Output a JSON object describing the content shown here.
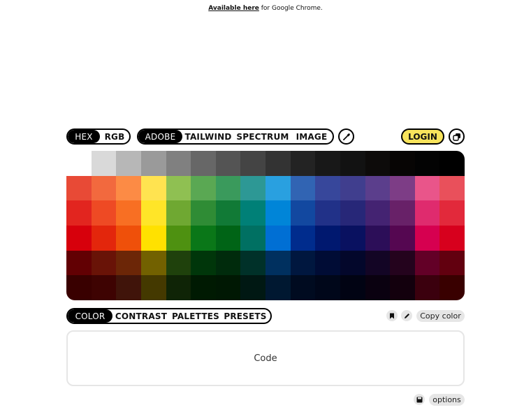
{
  "topbar": {
    "link_text": "Available here",
    "rest_text": " for Google Chrome."
  },
  "format_tabs": [
    {
      "label": "HEX",
      "active": true
    },
    {
      "label": "RGB",
      "active": false
    }
  ],
  "palette_tabs": [
    {
      "label": "ADOBE",
      "active": true
    },
    {
      "label": "TAILWIND",
      "active": false
    },
    {
      "label": "SPECTRUM",
      "active": false
    },
    {
      "label": "IMAGE",
      "active": false
    }
  ],
  "eyedropper_icon": "eyedropper-icon",
  "login_label": "LOGIN",
  "copy_icon": "copy-stack-icon",
  "swatches": [
    [
      "#ffffff",
      "#d9d9d9",
      "#b7b7b7",
      "#9a9a9a",
      "#808080",
      "#676767",
      "#545454",
      "#444444",
      "#333333",
      "#232323",
      "#181818",
      "#121212",
      "#0d0b0a",
      "#070504",
      "#030303",
      "#000000"
    ],
    [
      "#e84a36",
      "#f2693e",
      "#fc8b45",
      "#ffe350",
      "#8fc052",
      "#5aa853",
      "#3a9a5c",
      "#2d9895",
      "#29a0e0",
      "#3164b3",
      "#37479b",
      "#403e8e",
      "#5b3e8c",
      "#7d3d86",
      "#e9558a",
      "#e9505b"
    ],
    [
      "#e2251f",
      "#ee4a24",
      "#f86f23",
      "#ffe528",
      "#6fa832",
      "#2f8c35",
      "#117a36",
      "#008077",
      "#0085d8",
      "#1248a0",
      "#213188",
      "#272778",
      "#442372",
      "#682168",
      "#df2b6e",
      "#e2293b"
    ],
    [
      "#d7000c",
      "#e3260c",
      "#ef500a",
      "#ffe100",
      "#4e9111",
      "#0a7718",
      "#006416",
      "#007062",
      "#006fd4",
      "#002c8d",
      "#00186f",
      "#091160",
      "#2c0e58",
      "#550751",
      "#d60050",
      "#d7001d"
    ],
    [
      "#620003",
      "#691307",
      "#6c2607",
      "#726100",
      "#1f410c",
      "#00360a",
      "#002b0c",
      "#003129",
      "#00305f",
      "#00173f",
      "#000c35",
      "#03072b",
      "#130525",
      "#24031d",
      "#630027",
      "#62000f"
    ],
    [
      "#390000",
      "#3e0302",
      "#40140a",
      "#443900",
      "#0f2406",
      "#001a02",
      "#001803",
      "#001813",
      "#001831",
      "#000b20",
      "#00071a",
      "#010313",
      "#0a0110",
      "#13000d",
      "#3b000e",
      "#390000"
    ]
  ],
  "view_tabs": [
    {
      "label": "COLOR",
      "active": true
    },
    {
      "label": "CONTRAST",
      "active": false
    },
    {
      "label": "PALETTES",
      "active": false
    },
    {
      "label": "PRESETS",
      "active": false
    }
  ],
  "bookmark_icon": "bookmark-icon",
  "edit_icon": "pencil-icon",
  "copy_color_label": "Copy color",
  "code_placeholder": "Code",
  "save_icon": "save-icon",
  "options_label": "options"
}
